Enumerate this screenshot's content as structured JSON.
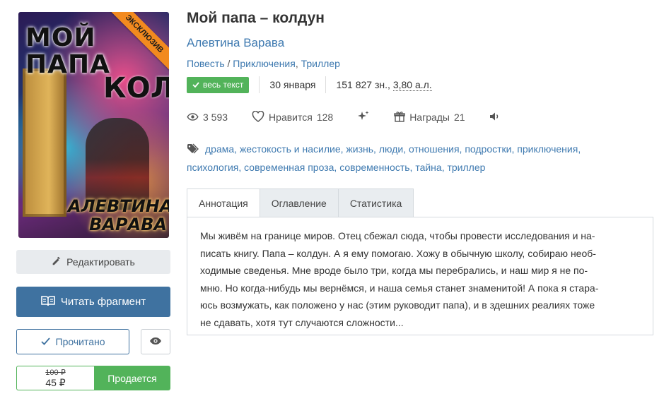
{
  "cover": {
    "title_line": "МОЙ ПАПА",
    "title_vertical": "КОЛДУН",
    "author_line": "АЛЕВТИНА ВАРАВА",
    "ribbon": "ЭКСКЛЮЗИВ"
  },
  "actions": {
    "edit": "Редактировать",
    "read_fragment": "Читать фрагмент",
    "read_done": "Прочитано",
    "price_old": "100 ₽",
    "price_new": "45 ₽",
    "on_sale": "Продается"
  },
  "book": {
    "title": "Мой папа – колдун",
    "author": "Алевтина Варава",
    "genres": [
      "Повесть",
      "Приключения",
      "Триллер"
    ],
    "status_badge": "весь текст",
    "date": "30 января",
    "size": "151 827 зн.",
    "size_al": "3,80 а.л.",
    "views": "3 593",
    "likes_label": "Нравится",
    "likes": "128",
    "awards_label": "Награды",
    "awards": "21"
  },
  "tags": [
    "драма",
    "жестокость и насилие",
    "жизнь",
    "люди",
    "отношения",
    "подростки",
    "приключения",
    "психология",
    "современная проза",
    "современность",
    "тайна",
    "триллер"
  ],
  "tabs": [
    "Аннотация",
    "Оглавление",
    "Статистика"
  ],
  "annotation_lines": [
    "Мы живём на границе миров. Отец сбежал сюда, чтобы провести исследования и на-",
    "писать книгу. Папа – колдун. А я ему помогаю. Хожу в обычную школу, собираю необ-",
    "ходимые сведенья. Мне вроде было три, когда мы перебрались, и наш мир я не по-",
    "мню. Но когда-нибудь мы вернёмся, и наша семья станет знаменитой! А пока я стара-",
    "юсь возмужать, как положено у нас (этим руководит папа), и в здешних реалиях тоже",
    "не сдавать, хотя тут случаются сложности..."
  ],
  "colors": {
    "link": "#3f7ab0",
    "primary": "#3f72a0",
    "success": "#52b35a",
    "ribbon": "#f28a1f"
  }
}
